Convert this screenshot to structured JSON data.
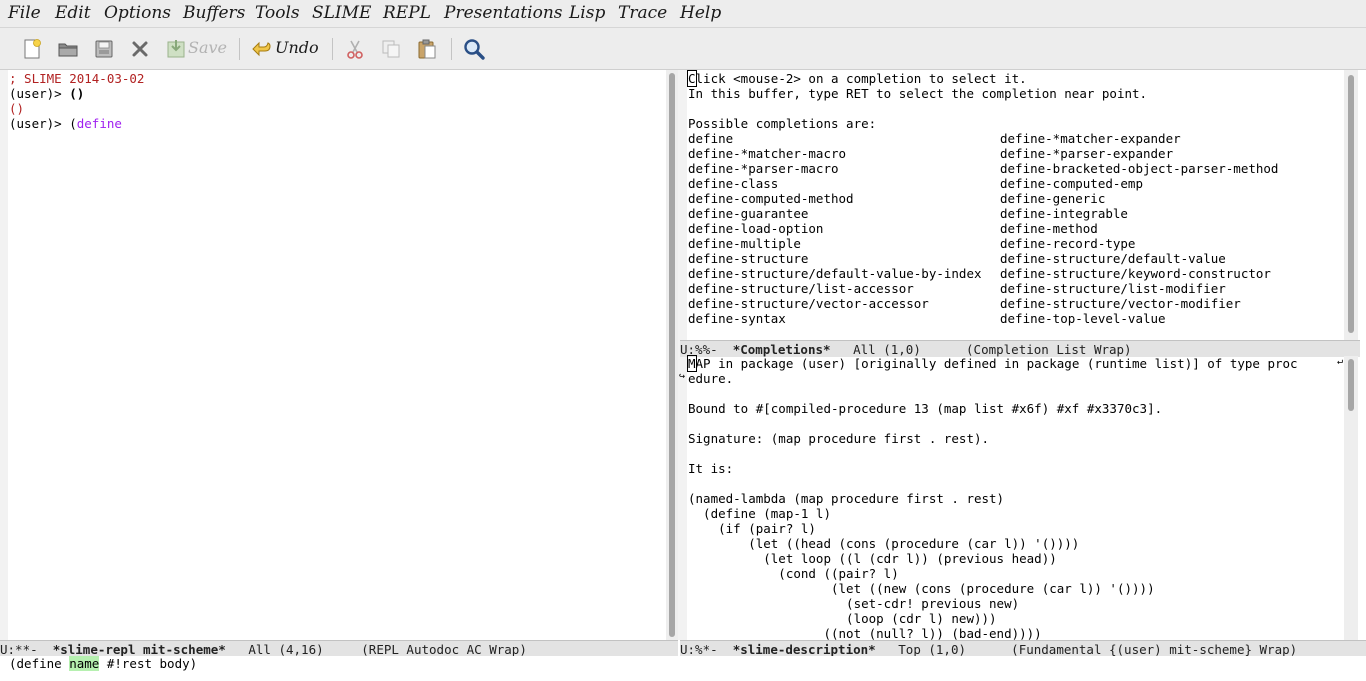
{
  "menubar": {
    "items": [
      "File",
      "Edit",
      "Options",
      "Buffers",
      "Tools",
      "SLIME",
      "REPL",
      "Presentations",
      "Lisp",
      "Trace",
      "Help"
    ]
  },
  "toolbar": {
    "buttons": [
      {
        "name": "new-file",
        "icon": "new-file-icon"
      },
      {
        "name": "open-file",
        "icon": "folder-icon"
      },
      {
        "name": "save-file",
        "icon": "disk-icon"
      },
      {
        "name": "close-buffer",
        "icon": "close-icon"
      },
      {
        "name": "save",
        "icon": "save-icon",
        "label": "Save"
      },
      {
        "name": "undo",
        "icon": "undo-icon",
        "label": "Undo"
      },
      {
        "name": "cut",
        "icon": "scissors-icon"
      },
      {
        "name": "copy",
        "icon": "copy-icon"
      },
      {
        "name": "paste",
        "icon": "paste-icon"
      },
      {
        "name": "search",
        "icon": "search-icon"
      }
    ]
  },
  "repl": {
    "lines": {
      "banner": "; SLIME 2014-03-02",
      "prompt1": "(user)> ",
      "input1": "()",
      "result1": "()",
      "prompt2": "(user)> ",
      "input2_paren": "(",
      "input2_kw": "define"
    },
    "modeline": {
      "status": "U:**-",
      "buffer": "*slime-repl mit-scheme*",
      "position": "All (4,16)",
      "modes": "(REPL Autodoc AC Wrap)"
    }
  },
  "completions": {
    "header1_cursor": "C",
    "header1_rest": "lick <mouse-2> on a completion to select it.",
    "header2": "In this buffer, type RET to select the completion near point.",
    "intro": "Possible completions are:",
    "rows": [
      [
        "define",
        "define-*matcher-expander"
      ],
      [
        "define-*matcher-macro",
        "define-*parser-expander"
      ],
      [
        "define-*parser-macro",
        "define-bracketed-object-parser-method"
      ],
      [
        "define-class",
        "define-computed-emp"
      ],
      [
        "define-computed-method",
        "define-generic"
      ],
      [
        "define-guarantee",
        "define-integrable"
      ],
      [
        "define-load-option",
        "define-method"
      ],
      [
        "define-multiple",
        "define-record-type"
      ],
      [
        "define-structure",
        "define-structure/default-value"
      ],
      [
        "define-structure/default-value-by-index",
        "define-structure/keyword-constructor"
      ],
      [
        "define-structure/list-accessor",
        "define-structure/list-modifier"
      ],
      [
        "define-structure/vector-accessor",
        "define-structure/vector-modifier"
      ],
      [
        "define-syntax",
        "define-top-level-value"
      ]
    ],
    "modeline": {
      "status": "U:%%-",
      "buffer": "*Completions*",
      "position": "All (1,0)",
      "modes": "(Completion List Wrap)"
    }
  },
  "description": {
    "line1_cursor": "M",
    "line1_rest": "AP in package (user) [originally defined in package (runtime list)] of type proc",
    "line2": "edure.",
    "bound": "Bound to #[compiled-procedure 13 (map list #x6f) #xf #x3370c3].",
    "signature": "Signature: (map procedure first . rest).",
    "itis": "It is:",
    "code": [
      "(named-lambda (map procedure first . rest)",
      "  (define (map-1 l)",
      "    (if (pair? l)",
      "        (let ((head (cons (procedure (car l)) '())))",
      "          (let loop ((l (cdr l)) (previous head))",
      "            (cond ((pair? l)",
      "                   (let ((new (cons (procedure (car l)) '())))",
      "                     (set-cdr! previous new)",
      "                     (loop (cdr l) new)))",
      "                  ((not (null? l)) (bad-end))))"
    ],
    "modeline": {
      "status": "U:%*-",
      "buffer": "*slime-description*",
      "position": "Top (1,0)",
      "modes": "(Fundamental {(user) mit-scheme} Wrap)"
    }
  },
  "echo": {
    "before": "(define ",
    "highlight": "name",
    "after": " #!rest body)"
  },
  "colors": {
    "comment": "#b22222",
    "keyword": "#a020f0",
    "highlight": "#b6f0b0"
  }
}
